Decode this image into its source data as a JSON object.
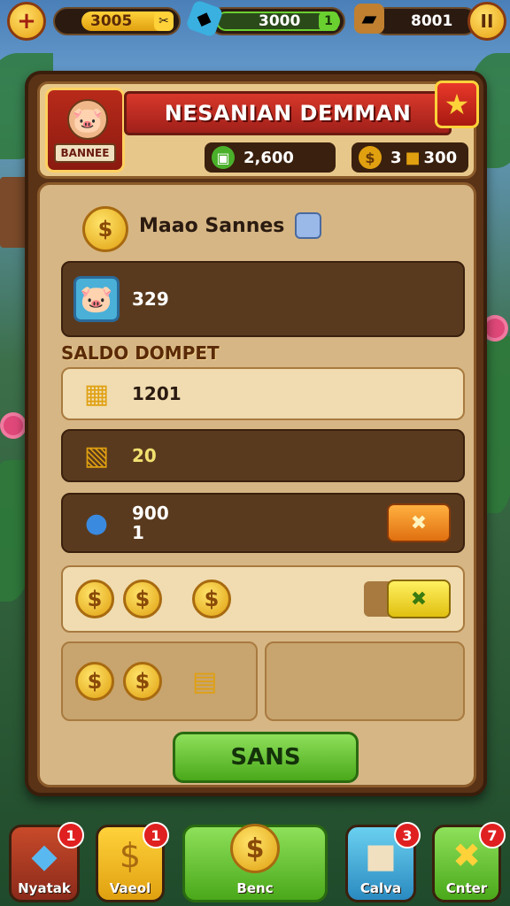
{
  "top_bar": {
    "add_label": "+",
    "coins_value": "3005",
    "coins_end": "✂",
    "gems_value": "3000",
    "gems_end": "1",
    "wood_value": "8001",
    "pause_label": "II"
  },
  "banner": {
    "title": "NESANIAN DEMMAN",
    "emblem_label": "BANNEE",
    "stat_cash": "2,600",
    "stat_gold": "3",
    "stat_box": "300"
  },
  "content": {
    "section_title": "Maao Sannes",
    "profile_value": "329",
    "wallet_label": "SALDO DOMPET",
    "rows": [
      {
        "value": "1201"
      },
      {
        "value": "20"
      },
      {
        "value": "900",
        "sub": "1"
      }
    ],
    "coin_glyph": "$",
    "action_glyph": "✖",
    "button_label": "SANS"
  },
  "nav": [
    {
      "label": "Nyatak",
      "badge": "1"
    },
    {
      "label": "Vaeol",
      "badge": "1"
    },
    {
      "label": "Benc",
      "badge": ""
    },
    {
      "label": "Calva",
      "badge": "3"
    },
    {
      "label": "Cnter",
      "badge": "7"
    }
  ],
  "colors": {
    "accent_green": "#4aa81a",
    "accent_red": "#d8382a",
    "panel_brown": "#5a3216",
    "parchment": "#d6b684"
  }
}
